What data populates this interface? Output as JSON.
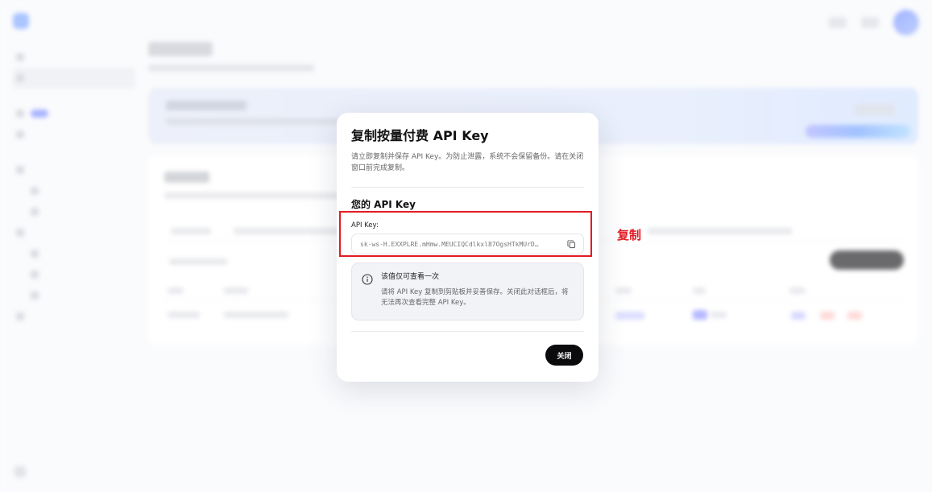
{
  "modal": {
    "title": "复制按量付费 API Key",
    "description": "请立即复制并保存 API Key。为防止泄露，系统不会保留备份。请在关闭窗口前完成复制。",
    "key_section_title": "您的 API Key",
    "key_label": "API Key:",
    "key_value": "sk-ws-H.EXXPLRE.mHmw.MEUCIQCdlkxl87OgsHTkMUrD…",
    "notice_title": "该值仅可查看一次",
    "notice_text": "请将 API Key 复制到剪贴板并妥善保存。关闭此对话框后，将无法再次查看完整 API Key。",
    "close_label": "关闭"
  },
  "annotation": {
    "label": "复制",
    "color": "#e31b23"
  },
  "icons": {
    "copy": "copy-icon",
    "info": "info-icon"
  }
}
